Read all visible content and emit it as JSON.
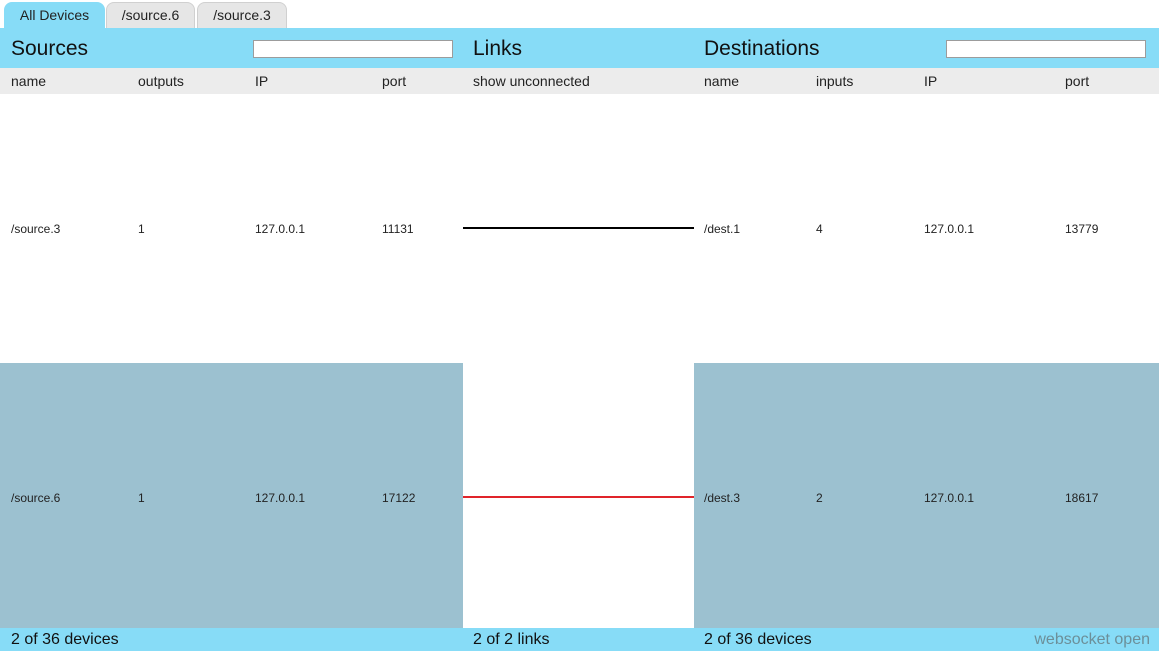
{
  "tabs": [
    "All Devices",
    "/source.6",
    "/source.3"
  ],
  "sources": {
    "title": "Sources",
    "search_value": "",
    "columns": [
      "name",
      "outputs",
      "IP",
      "port"
    ],
    "rows": [
      {
        "name": "/source.3",
        "outputs": "1",
        "ip": "127.0.0.1",
        "port": "11131"
      },
      {
        "name": "/source.6",
        "outputs": "1",
        "ip": "127.0.0.1",
        "port": "17122"
      }
    ]
  },
  "links": {
    "title": "Links",
    "column": "show unconnected",
    "colors": [
      "#000000",
      "#e0242a"
    ]
  },
  "destinations": {
    "title": "Destinations",
    "search_value": "",
    "columns": [
      "name",
      "inputs",
      "IP",
      "port"
    ],
    "rows": [
      {
        "name": "/dest.1",
        "inputs": "4",
        "ip": "127.0.0.1",
        "port": "13779"
      },
      {
        "name": "/dest.3",
        "inputs": "2",
        "ip": "127.0.0.1",
        "port": "18617"
      }
    ]
  },
  "footer": {
    "sources_count": "2 of 36 devices",
    "links_count": "2 of 2 links",
    "destinations_count": "2 of 36 devices",
    "status": "websocket open"
  },
  "colors": {
    "accent": "#87dcf7",
    "selected_row": "#9cc1d0",
    "header_gray": "#ececec"
  }
}
